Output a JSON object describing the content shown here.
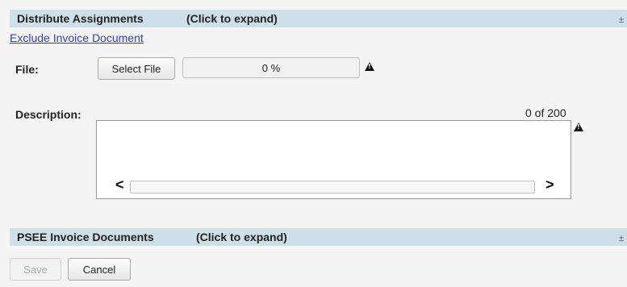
{
  "sections": {
    "distribute": {
      "title": "Distribute Assignments",
      "hint": "(Click to expand)",
      "expand_icon": "±"
    },
    "psee": {
      "title": "PSEE Invoice Documents",
      "hint": "(Click to expand)",
      "expand_icon": "±"
    }
  },
  "exclude_link": "Exclude Invoice Document",
  "file": {
    "label": "File:",
    "select_button": "Select File",
    "progress_text": "0 %",
    "progress_value": 0,
    "warning_icon": "warning-icon"
  },
  "description": {
    "label": "Description:",
    "counter": "0 of 200",
    "value": "",
    "warning_icon": "warning-icon",
    "scroll_left": "<",
    "scroll_right": ">"
  },
  "actions": {
    "save_label": "Save",
    "cancel_label": "Cancel"
  },
  "colors": {
    "section_bar": "#cfdfe8",
    "link": "#2a3ec8",
    "background": "#f4f4f4"
  }
}
